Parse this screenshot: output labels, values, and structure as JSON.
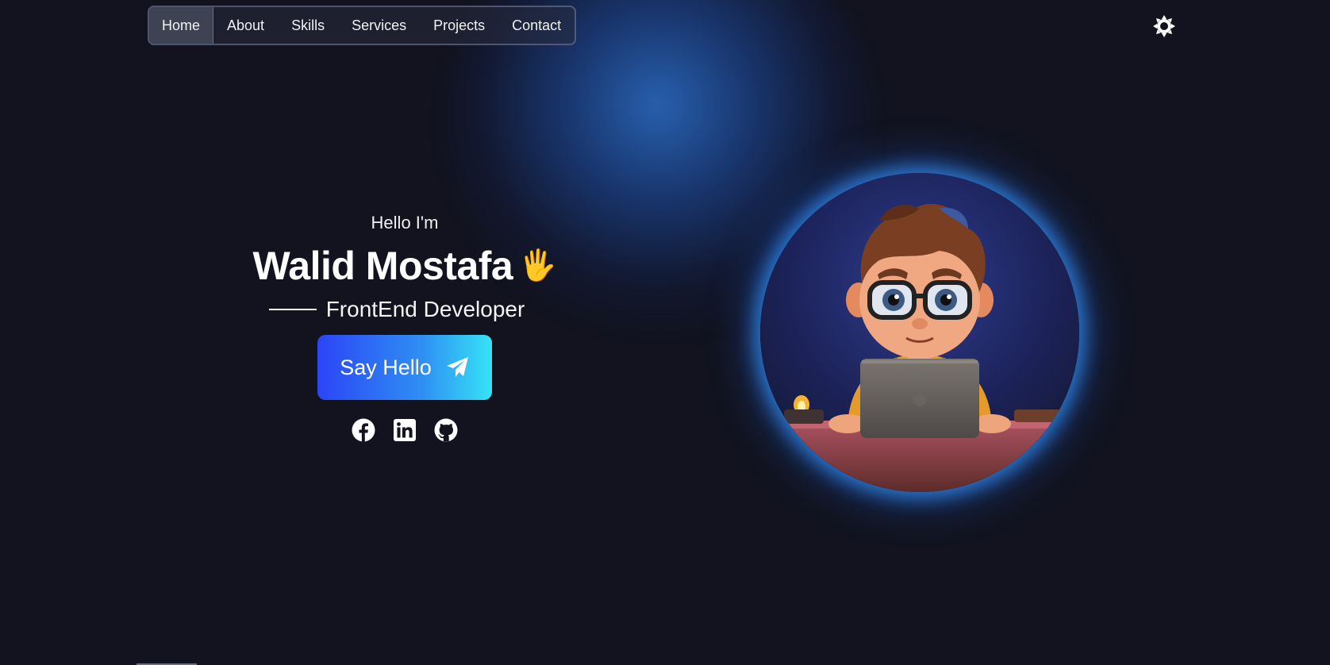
{
  "nav": {
    "items": [
      {
        "label": "Home",
        "active": true
      },
      {
        "label": "About"
      },
      {
        "label": "Skills"
      },
      {
        "label": "Services"
      },
      {
        "label": "Projects"
      },
      {
        "label": "Contact"
      }
    ]
  },
  "theme_toggle": {
    "icon": "sun-icon"
  },
  "hero": {
    "greeting": "Hello I'm",
    "name": "Walid Mostafa",
    "wave_emoji": "🖐",
    "role": "FrontEnd Developer",
    "cta_label": "Say Hello",
    "cta_icon": "paper-plane-icon"
  },
  "socials": [
    {
      "icon": "facebook-icon"
    },
    {
      "icon": "linkedin-icon"
    },
    {
      "icon": "github-icon"
    }
  ],
  "avatar": {
    "description_icon": "developer-avatar-image"
  },
  "colors": {
    "background": "#12131f",
    "accent_start": "#2b45f6",
    "accent_end": "#36e3f6",
    "glow": "#2c6ec8"
  }
}
